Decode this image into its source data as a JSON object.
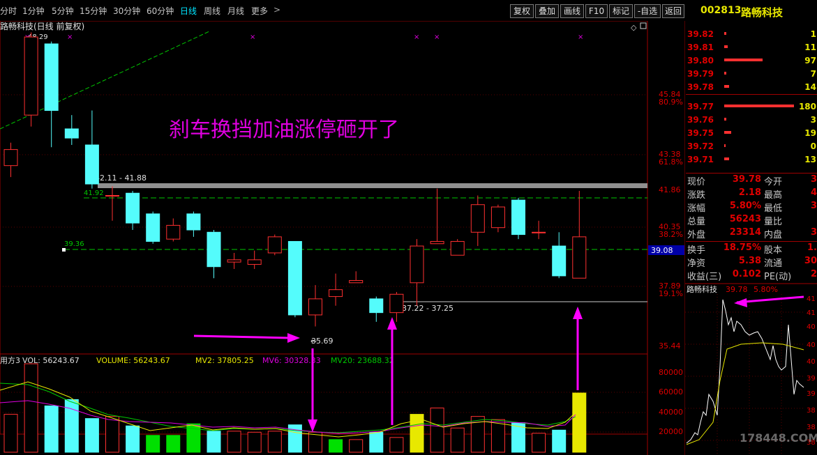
{
  "toolbar": {
    "periods": [
      "分时",
      "1分钟",
      "5分钟",
      "15分钟",
      "30分钟",
      "60分钟",
      "日线",
      "周线",
      "月线",
      "更多"
    ],
    "active_period": "日线",
    "buttons": [
      "复权",
      "叠加",
      "画线",
      "F10",
      "标记",
      "-自选",
      "返回"
    ]
  },
  "chart_title": "路畅科技(日线 前复权)",
  "annotation_text": "刹车换挡加油涨停砸开了",
  "price_labels": {
    "high_mark": "48.29",
    "range_top": "42.11 - 41.88",
    "line_upper": "41.92",
    "line_lower": "39.36",
    "low_mark": "35.69",
    "range_bottom": "37.22 - 37.25",
    "current_marker": "39.08"
  },
  "y_axis": [
    {
      "price": "45.84",
      "pct": "80.9%"
    },
    {
      "price": "43.38",
      "pct": "61.8%"
    },
    {
      "price": "41.86",
      "pct": ""
    },
    {
      "price": "40.35",
      "pct": "38.2%"
    },
    {
      "price": "37.89",
      "pct": "19.1%"
    },
    {
      "price": "35.44",
      "pct": ""
    }
  ],
  "volume_header": {
    "prefix": "用方3",
    "vol": "VOL: 56243.67",
    "volume": "VOLUME: 56243.67",
    "mv2": "MV2: 37805.25",
    "mv6": "MV6: 30328.33",
    "mv20": "MV20: 23688.32"
  },
  "volume_axis": [
    "80000",
    "60000",
    "40000",
    "20000"
  ],
  "colors": {
    "up": "#ff3030",
    "down": "#54fcfc",
    "ma_green": "#00c800",
    "ma_magenta": "#e000e0",
    "ma_yellow": "#e8e800",
    "arrow": "#ff00ff"
  },
  "chart_data": {
    "type": "candlestick",
    "ylim": [
      34.5,
      49.0
    ],
    "candles": [
      {
        "o": 42.7,
        "c": 43.4,
        "h": 43.7,
        "l": 42.2
      },
      {
        "o": 44.9,
        "c": 48.3,
        "h": 48.5,
        "l": 44.4
      },
      {
        "o": 48.0,
        "c": 45.1,
        "h": 48.1,
        "l": 43.5
      },
      {
        "o": 44.3,
        "c": 43.9,
        "h": 44.9,
        "l": 43.6
      },
      {
        "o": 43.6,
        "c": 41.9,
        "h": 45.1,
        "l": 41.7
      },
      {
        "o": 41.4,
        "c": 41.4,
        "h": 41.8,
        "l": 40.3
      },
      {
        "o": 41.5,
        "c": 40.2,
        "h": 41.6,
        "l": 39.9
      },
      {
        "o": 40.6,
        "c": 39.4,
        "h": 40.7,
        "l": 39.3
      },
      {
        "o": 39.5,
        "c": 40.1,
        "h": 40.4,
        "l": 39.4
      },
      {
        "o": 40.6,
        "c": 39.9,
        "h": 40.7,
        "l": 39.6
      },
      {
        "o": 39.8,
        "c": 38.3,
        "h": 39.9,
        "l": 37.8
      },
      {
        "o": 38.5,
        "c": 38.6,
        "h": 38.9,
        "l": 38.2
      },
      {
        "o": 38.4,
        "c": 38.6,
        "h": 39.0,
        "l": 38.2
      },
      {
        "o": 38.9,
        "c": 39.6,
        "h": 39.7,
        "l": 38.8
      },
      {
        "o": 39.4,
        "c": 36.2,
        "h": 39.4,
        "l": 36.1
      },
      {
        "o": 36.2,
        "c": 36.9,
        "h": 37.5,
        "l": 35.7
      },
      {
        "o": 37.0,
        "c": 37.3,
        "h": 38.0,
        "l": 36.6
      },
      {
        "o": 37.6,
        "c": 37.7,
        "h": 38.1,
        "l": 37.6
      },
      {
        "o": 36.9,
        "c": 36.3,
        "h": 37.0,
        "l": 35.9
      },
      {
        "o": 36.3,
        "c": 37.1,
        "h": 37.2,
        "l": 35.9
      },
      {
        "o": 37.6,
        "c": 39.2,
        "h": 39.5,
        "l": 36.6
      },
      {
        "o": 39.3,
        "c": 39.4,
        "h": 41.7,
        "l": 39.3
      },
      {
        "o": 38.8,
        "c": 39.4,
        "h": 39.5,
        "l": 38.8
      },
      {
        "o": 39.8,
        "c": 41.0,
        "h": 41.4,
        "l": 39.2
      },
      {
        "o": 40.0,
        "c": 40.9,
        "h": 41.0,
        "l": 39.8
      },
      {
        "o": 41.2,
        "c": 39.7,
        "h": 41.3,
        "l": 39.5
      },
      {
        "o": 39.8,
        "c": 39.8,
        "h": 40.3,
        "l": 39.5
      },
      {
        "o": 39.2,
        "c": 37.9,
        "h": 39.8,
        "l": 37.8
      },
      {
        "o": 37.8,
        "c": 39.6,
        "h": 41.6,
        "l": 37.8
      }
    ],
    "volumes": [
      36000,
      84000,
      44000,
      50000,
      32000,
      34000,
      25000,
      16000,
      16000,
      27000,
      20000,
      20000,
      19000,
      20000,
      26000,
      19000,
      12000,
      12000,
      19000,
      14000,
      36000,
      42000,
      23000,
      34000,
      31000,
      28000,
      18000,
      21000,
      56243
    ],
    "volume_ylim": [
      0,
      92000
    ]
  },
  "stock_header": {
    "code": "002813",
    "name": "路畅科技"
  },
  "order_book": {
    "asks": [
      {
        "price": "39.82",
        "vol": "1",
        "bar": 3
      },
      {
        "price": "39.81",
        "vol": "11",
        "bar": 5
      },
      {
        "price": "39.80",
        "vol": "97",
        "bar": 55
      },
      {
        "price": "39.79",
        "vol": "7",
        "bar": 3
      },
      {
        "price": "39.78",
        "vol": "14",
        "bar": 7
      }
    ],
    "bids": [
      {
        "price": "39.77",
        "vol": "180",
        "bar": 100
      },
      {
        "price": "39.76",
        "vol": "3",
        "bar": 3
      },
      {
        "price": "39.75",
        "vol": "19",
        "bar": 10
      },
      {
        "price": "39.72",
        "vol": "0",
        "bar": 2
      },
      {
        "price": "39.71",
        "vol": "13",
        "bar": 7
      }
    ]
  },
  "quote": [
    {
      "l1": "现价",
      "v1": "39.78",
      "l2": "今开",
      "v2": "3"
    },
    {
      "l1": "涨跌",
      "v1": "2.18",
      "l2": "最高",
      "v2": "4"
    },
    {
      "l1": "涨幅",
      "v1": "5.80%",
      "l2": "最低",
      "v2": "3"
    },
    {
      "l1": "总量",
      "v1": "56243",
      "l2": "量比",
      "v2": ""
    },
    {
      "l1": "外盘",
      "v1": "23314",
      "l2": "内盘",
      "v2": "3"
    }
  ],
  "quote2": [
    {
      "l1": "换手",
      "v1": "18.75%",
      "l2": "股本",
      "v2": "1."
    },
    {
      "l1": "净资",
      "v1": "5.38",
      "l2": "流通",
      "v2": "30"
    },
    {
      "l1": "收益(三)",
      "v1": "0.102",
      "l2": "PE(动)",
      "v2": "2"
    }
  ],
  "mini_chart": {
    "title": "路畅科技",
    "price": "39.78",
    "pct": "5.80%",
    "axis": [
      "41",
      "41",
      "40",
      "40",
      "40",
      "39",
      "39",
      "38",
      "38",
      "38"
    ],
    "watermark": "178448.COM"
  }
}
